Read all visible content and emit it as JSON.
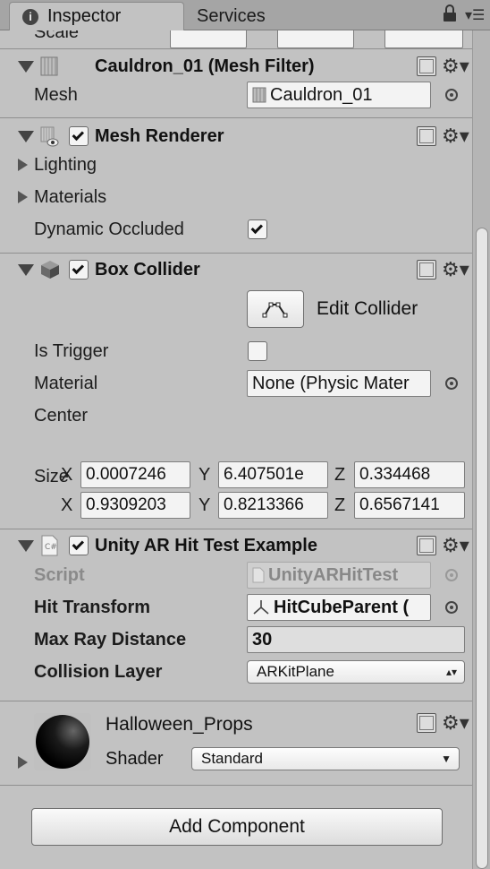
{
  "tabs": {
    "inspector": "Inspector",
    "services": "Services"
  },
  "top_partial_label": "Scale",
  "mesh_filter": {
    "title": "Cauldron_01 (Mesh Filter)",
    "mesh_label": "Mesh",
    "mesh_value": "Cauldron_01"
  },
  "mesh_renderer": {
    "title": "Mesh Renderer",
    "lighting": "Lighting",
    "materials": "Materials",
    "dynamic_occluded": "Dynamic Occluded"
  },
  "box_collider": {
    "title": "Box Collider",
    "edit_collider": "Edit Collider",
    "is_trigger": "Is Trigger",
    "material_label": "Material",
    "material_value": "None (Physic Mater",
    "center_label": "Center",
    "center": {
      "x": "0.0007246",
      "y": "6.407501e",
      "z": "0.334468"
    },
    "size_label": "Size",
    "size": {
      "x": "0.9309203",
      "y": "0.8213366",
      "z": "0.6567141"
    },
    "axis_x": "X",
    "axis_y": "Y",
    "axis_z": "Z"
  },
  "ar_hit_test": {
    "title": "Unity AR Hit Test Example",
    "script_label": "Script",
    "script_value": "UnityARHitTest",
    "hit_transform_label": "Hit Transform",
    "hit_transform_value": "HitCubeParent (",
    "max_ray_label": "Max Ray Distance",
    "max_ray_value": "30",
    "collision_layer_label": "Collision Layer",
    "collision_layer_value": "ARKitPlane"
  },
  "material": {
    "name": "Halloween_Props",
    "shader_label": "Shader",
    "shader_value": "Standard"
  },
  "add_component": "Add Component",
  "icons": [
    "info-icon",
    "lock-icon",
    "menu-icon",
    "help-icon",
    "gear-icon",
    "mesh-icon",
    "box-icon",
    "script-icon",
    "transform-icon"
  ]
}
